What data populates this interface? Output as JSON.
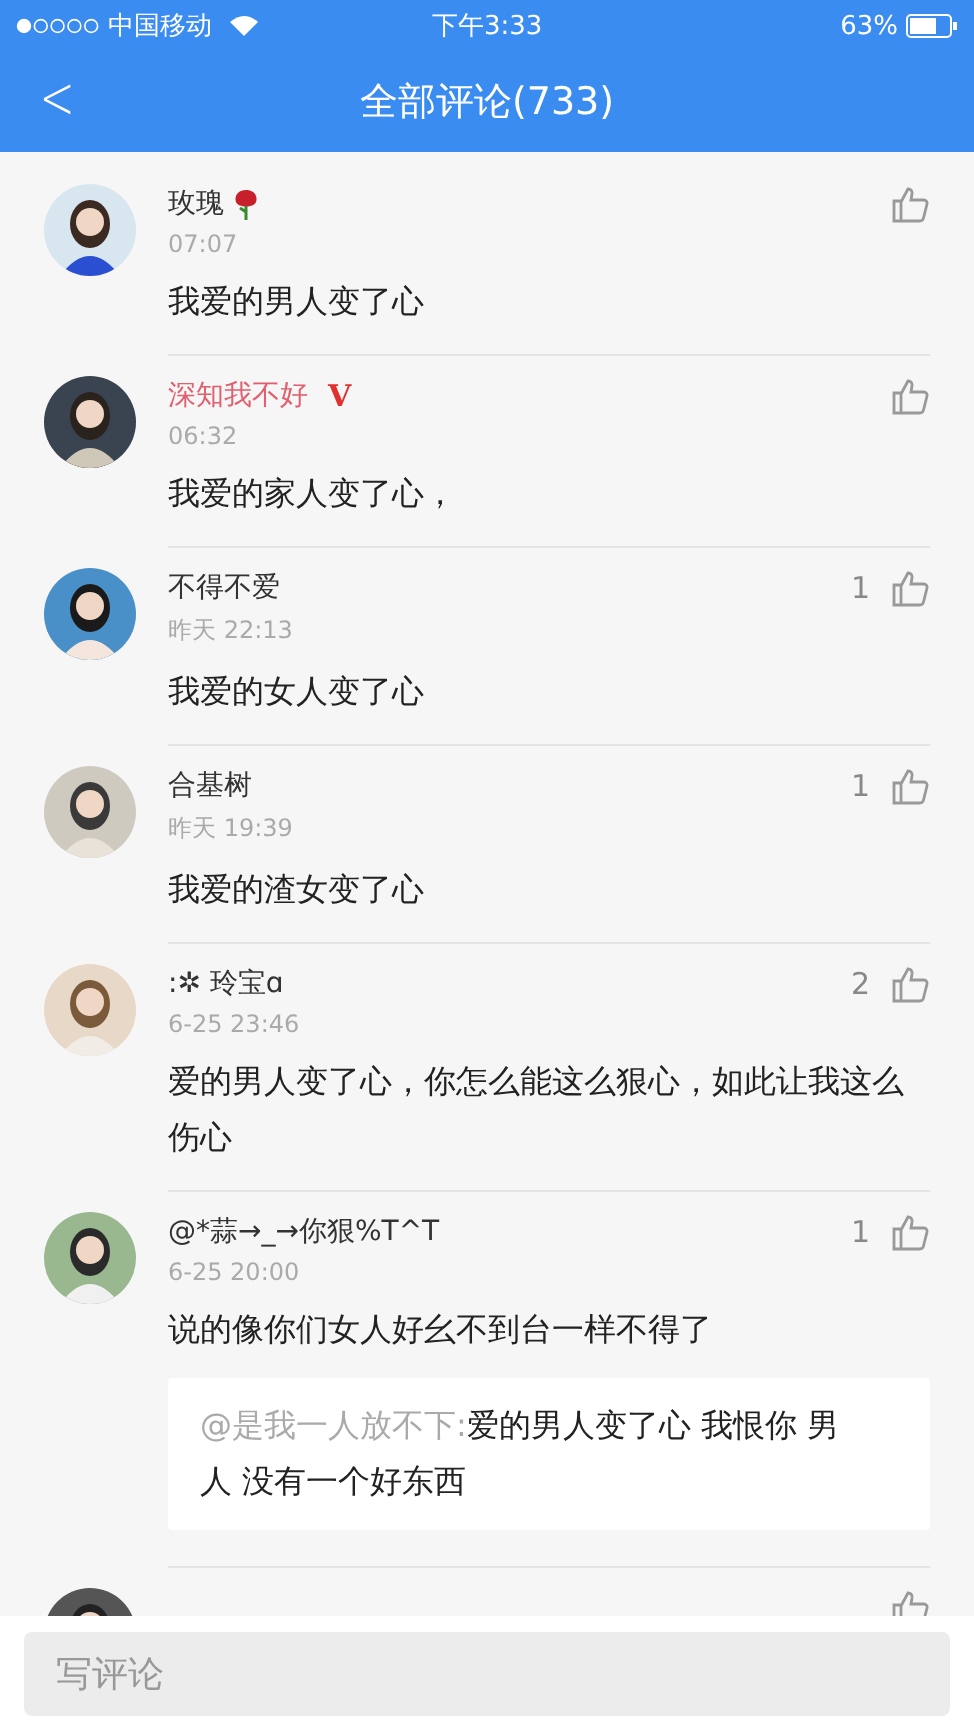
{
  "status_bar": {
    "carrier": "中国移动",
    "time": "下午3:33",
    "battery": "63%"
  },
  "header": {
    "back": "<",
    "title": "全部评论(733)"
  },
  "comments": [
    {
      "name": "玫瑰",
      "rose": true,
      "vip": false,
      "time": "07:07",
      "text": "我爱的男人变了心"
    },
    {
      "name": "深知我不好",
      "rose": false,
      "vip": true,
      "badge": "V",
      "time": "06:32",
      "text": "我爱的家人变了心，"
    },
    {
      "name": "不得不爱",
      "rose": false,
      "vip": false,
      "time": "昨天 22:13",
      "likes": "1",
      "text": "我爱的女人变了心"
    },
    {
      "name": "合基树",
      "rose": false,
      "vip": false,
      "time": "昨天 19:39",
      "likes": "1",
      "text": "我爱的渣女变了心"
    },
    {
      "name": ":✲  玲宝ɑ",
      "rose": false,
      "vip": false,
      "time": "6-25 23:46",
      "likes": "2",
      "text": "爱的男人变了心，你怎么能这么狠心，如此让我这么伤心"
    },
    {
      "name": "@*蒜→_→你狠%T^T",
      "rose": false,
      "vip": false,
      "time": "6-25 20:00",
      "likes": "1",
      "text": "说的像你们女人好幺不到台一样不得了",
      "reply": {
        "author": "@是我一人放不下:",
        "text": "爱的男人变了心 我恨你 男人 没有一个好东西"
      }
    }
  ],
  "composer": {
    "placeholder": "写评论"
  }
}
